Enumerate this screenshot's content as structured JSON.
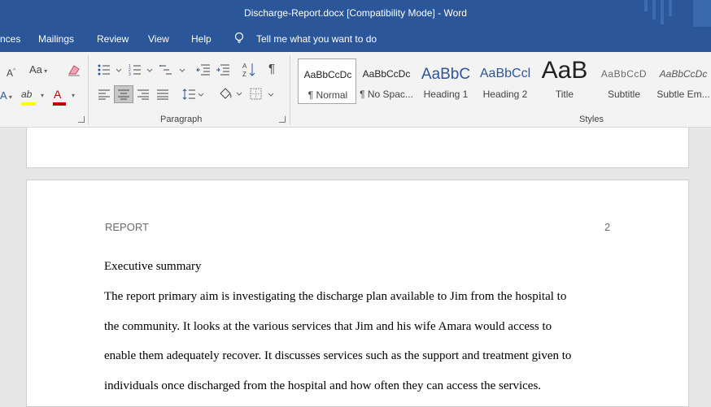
{
  "window": {
    "title": "Discharge-Report.docx [Compatibility Mode]  -  Word"
  },
  "menu": {
    "tabs": [
      "nces",
      "Mailings",
      "Review",
      "View",
      "Help"
    ],
    "tell_me": "Tell me what you want to do"
  },
  "ribbon": {
    "font_group": {
      "grow_font": "A",
      "change_case": "Aa",
      "font_color_letter": "A",
      "highlight_letters": "ab"
    },
    "paragraph_group": {
      "label": "Paragraph",
      "pilcrow": "¶"
    },
    "styles_group": {
      "label": "Styles",
      "items": [
        {
          "sample": "AaBbCcDc",
          "name": "¶ Normal",
          "selected": true
        },
        {
          "sample": "AaBbCcDc",
          "name": "¶ No Spac...",
          "selected": false
        },
        {
          "sample": "AaBbC",
          "name": "Heading 1",
          "selected": false
        },
        {
          "sample": "AaBbCcl",
          "name": "Heading 2",
          "selected": false
        },
        {
          "sample": "AaB",
          "name": "Title",
          "selected": false
        },
        {
          "sample": "AaBbCcD",
          "name": "Subtitle",
          "selected": false
        },
        {
          "sample": "AaBbCcDc",
          "name": "Subtle Em...",
          "selected": false
        }
      ]
    }
  },
  "document": {
    "header_left": "REPORT",
    "page_number": "2",
    "heading": "Executive summary",
    "lines": [
      "The report primary aim is investigating the discharge plan available to Jim from the hospital to",
      "the community. It looks at the various services that Jim and his wife Amara would access to",
      "enable them adequately recover. It discusses services such as the support and treatment given to",
      "individuals once discharged from the hospital and how often they can access the services."
    ]
  },
  "colors": {
    "titlebar": "#2b579a",
    "ribbon": "#f3f3f3",
    "canvas": "#e6e6e6",
    "font_color_bar": "#c00000",
    "highlight_bar": "#ffff00"
  }
}
